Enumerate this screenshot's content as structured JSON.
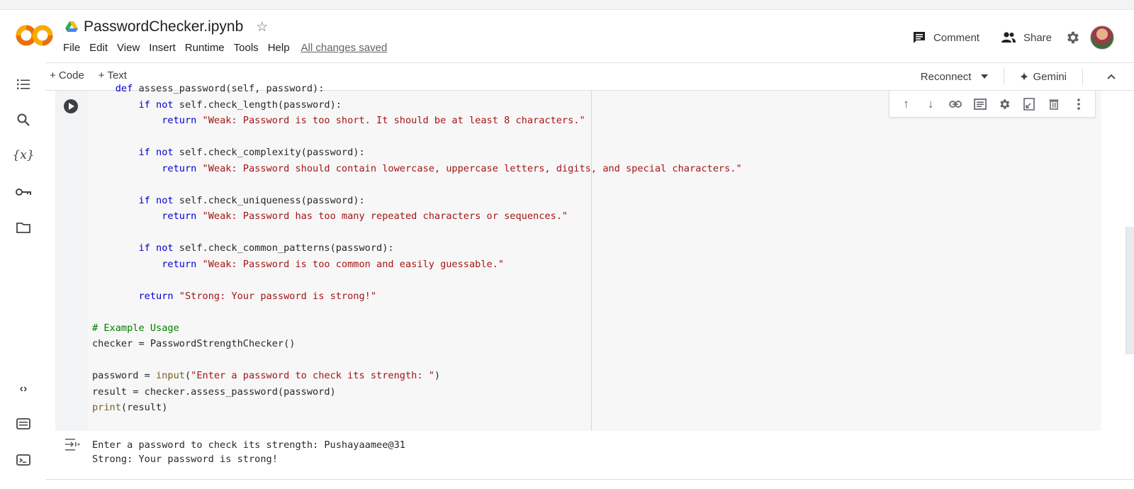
{
  "header": {
    "notebook_title": "PasswordChecker.ipynb",
    "menu": [
      "File",
      "Edit",
      "View",
      "Insert",
      "Runtime",
      "Tools",
      "Help"
    ],
    "save_status": "All changes saved",
    "comment_label": "Comment",
    "share_label": "Share",
    "logo_text": "CO"
  },
  "toolbar": {
    "add_code_label": "+ Code",
    "add_text_label": "+ Text",
    "reconnect_label": "Reconnect",
    "gemini_label": "Gemini"
  },
  "left_rail_icons": [
    "table-of-contents-icon",
    "search-icon",
    "variables-icon",
    "secrets-key-icon",
    "files-folder-icon",
    "code-snippets-icon",
    "command-palette-icon",
    "terminal-icon"
  ],
  "cell_toolbar_icons": [
    "move-up-icon",
    "move-down-icon",
    "link-icon",
    "comment-icon",
    "settings-icon",
    "mirror-cell-icon",
    "delete-icon",
    "more-icon"
  ],
  "code_cell": {
    "lines": [
      "    def assess_password(self, password):",
      "        if not self.check_length(password):",
      "            return \"Weak: Password is too short. It should be at least 8 characters.\"",
      "",
      "        if not self.check_complexity(password):",
      "            return \"Weak: Password should contain lowercase, uppercase letters, digits, and special characters.\"",
      "",
      "        if not self.check_uniqueness(password):",
      "            return \"Weak: Password has too many repeated characters or sequences.\"",
      "",
      "        if not self.check_common_patterns(password):",
      "            return \"Weak: Password is too common and easily guessable.\"",
      "",
      "        return \"Strong: Your password is strong!\"",
      "",
      "# Example Usage",
      "checker = PasswordStrengthChecker()",
      "",
      "password = input(\"Enter a password to check its strength: \")",
      "result = checker.assess_password(password)",
      "print(result)"
    ]
  },
  "output": {
    "lines": [
      "Enter a password to check its strength: Pushayaamee@31",
      "Strong: Your password is strong!"
    ]
  },
  "colors": {
    "keyword": "#0000d0",
    "string": "#a31515",
    "comment": "#008000",
    "builtin": "#795e26",
    "logo_orange": "#f9ab00",
    "logo_dark_orange": "#e8710a"
  }
}
